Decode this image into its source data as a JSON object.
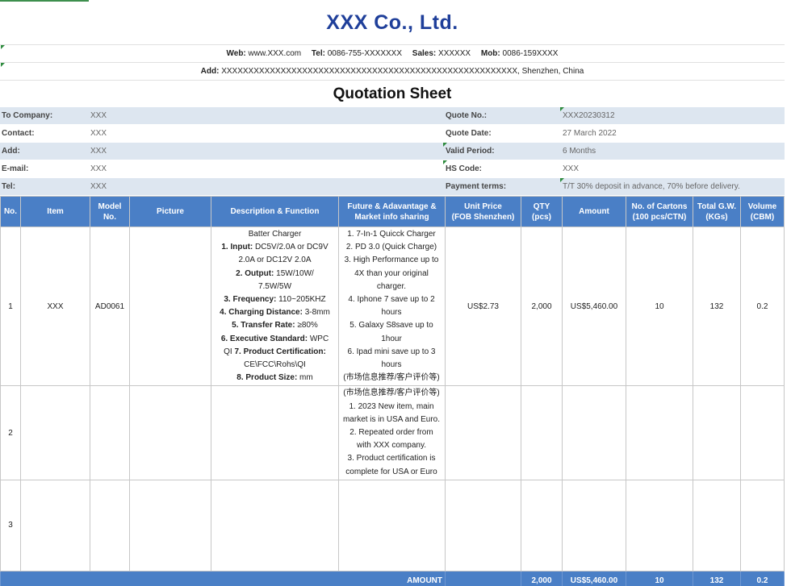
{
  "header": {
    "company": "XXX Co., Ltd.",
    "web_label": "Web:",
    "web": "www.XXX.com",
    "tel_label": "Tel:",
    "tel": "0086-755-XXXXXXX",
    "sales_label": "Sales:",
    "sales": "XXXXXX",
    "mob_label": "Mob:",
    "mob": "0086-159XXXX",
    "add_label": "Add:",
    "address": "XXXXXXXXXXXXXXXXXXXXXXXXXXXXXXXXXXXXXXXXXXXXXXXXXXXXXXX, Shenzhen, China",
    "title": "Quotation Sheet"
  },
  "info": {
    "to_company_label": "To Company:",
    "to_company": "XXX",
    "contact_label": "Contact:",
    "contact": "XXX",
    "add_label": "Add:",
    "add": "XXX",
    "email_label": "E-mail:",
    "email": "XXX",
    "tel_label": "Tel:",
    "tel": "XXX",
    "quote_no_label": "Quote No.:",
    "quote_no": "XXX20230312",
    "quote_date_label": "Quote Date:",
    "quote_date": "27 March 2022",
    "valid_label": "Valid Period:",
    "valid": "6 Months",
    "hs_label": "HS Code:",
    "hs": "XXX",
    "payment_label": "Payment terms:",
    "payment": "T/T 30% deposit in advance, 70% before delivery."
  },
  "columns": {
    "no": "No.",
    "item": "Item",
    "model_1": "Model",
    "model_2": "No.",
    "picture": "Picture",
    "desc": "Description & Function",
    "feat_1": "Future & Adavantage &",
    "feat_2": "Market  info  sharing",
    "price_1": "Unit Price",
    "price_2": "(FOB Shenzhen)",
    "qty_1": "QTY",
    "qty_2": "(pcs)",
    "amount": "Amount",
    "cartons_1": "No. of Cartons",
    "cartons_2": "(100 pcs/CTN)",
    "gw_1": "Total G.W.",
    "gw_2": "(KGs)",
    "vol_1": "Volume",
    "vol_2": "(CBM)"
  },
  "rows": [
    {
      "no": "1",
      "item": "XXX",
      "model": "AD0061",
      "desc": {
        "l0": "Batter Charger",
        "l1b": "1. Input:",
        "l1": " DC5V/2.0A or DC9V",
        "l1c": "2.0A or DC12V 2.0A",
        "l2b": "2. Output:",
        "l2": " 15W/10W/",
        "l2c": "7.5W/5W",
        "l3b": "3. Frequency:",
        "l3": " 110~205KHZ",
        "l4b": "4. Charging Distance:",
        "l4": " 3-8mm",
        "l5b": "5. Transfer Rate:",
        "l5": " ≥80%",
        "l6b": "6. Executive Standard:",
        "l6": " WPC",
        "l6c": "QI ",
        "l7b": "7. Product Certification:",
        "l7c": "CE\\FCC\\Rohs\\QI",
        "l8b": "8. Product Size:",
        "l8": "    mm"
      },
      "feat": [
        "1. 7-In-1 Quicck Charger",
        "2. PD 3.0 (Quick Charge)",
        "3. High Performance up to",
        "4X than your original",
        "charger.",
        "4. Iphone 7 save up to 2",
        "hours",
        "5. Galaxy S8save up to",
        "1hour",
        "6. Ipad mini save up to 3",
        "hours",
        "(市场信息推荐/客户评价等)"
      ],
      "price": "US$2.73",
      "qty": "2,000",
      "amount": "US$5,460.00",
      "cartons": "10",
      "gw": "132",
      "vol": "0.2"
    },
    {
      "no": "2",
      "feat": [
        "(市场信息推荐/客户评价等)",
        "1. 2023 New item, main",
        "market is in USA and Euro.",
        "2. Repeated order from",
        "with XXX company.",
        "3. Product certification is",
        "complete for USA or Euro"
      ]
    },
    {
      "no": "3"
    }
  ],
  "total": {
    "label": "AMOUNT",
    "qty": "2,000",
    "amount": "US$5,460.00",
    "cartons": "10",
    "gw": "132",
    "vol": "0.2"
  }
}
